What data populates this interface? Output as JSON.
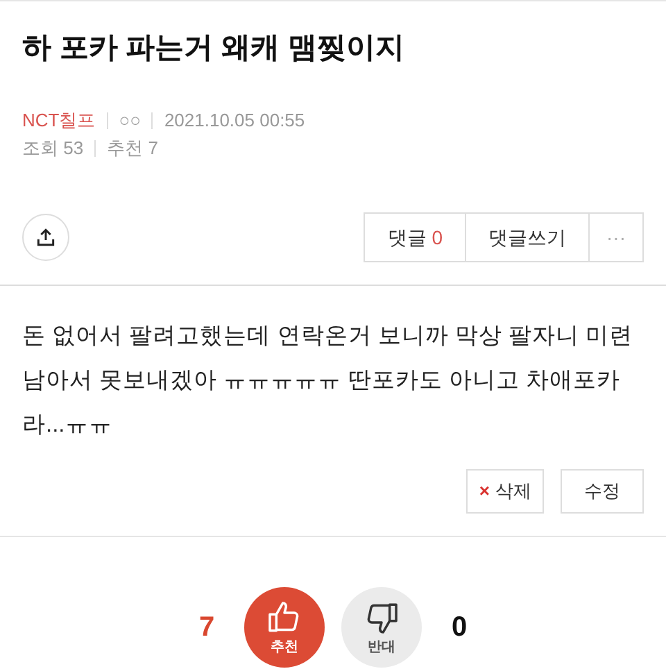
{
  "title": "하 포카 파는거 왜캐 맴찢이지",
  "meta": {
    "author": "NCT칠프",
    "badge": "○○",
    "date": "2021.10.05 00:55",
    "views_label": "조회",
    "views": "53",
    "recommend_label": "추천",
    "recommend": "7"
  },
  "toolbar": {
    "comments_label": "댓글",
    "comments_count": "0",
    "write_comment": "댓글쓰기",
    "more": "···"
  },
  "body": "돈 없어서 팔려고했는데 연락온거 보니까 막상 팔자니 미련 남아서 못보내겠아 ㅠㅠㅠㅠㅠ 딴포카도 아니고 차애포카라...ㅠㅠ",
  "actions": [
    {
      "kind": "delete",
      "label": "삭제",
      "icon": "×"
    },
    {
      "kind": "edit",
      "label": "수정"
    }
  ],
  "votes": [
    {
      "kind": "up",
      "label": "추천",
      "count": "7",
      "selected": true
    },
    {
      "kind": "down",
      "label": "반대",
      "count": "0",
      "selected": false
    }
  ]
}
